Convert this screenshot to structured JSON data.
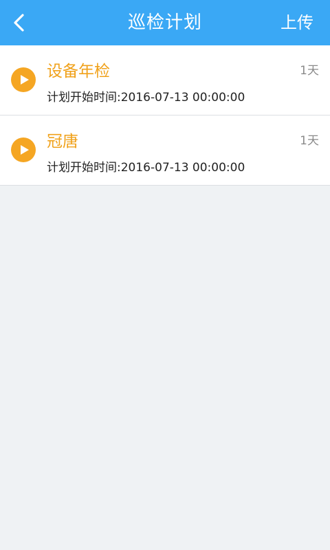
{
  "header": {
    "title": "巡检计划",
    "upload_label": "上传",
    "back_icon": "chevron-left-icon"
  },
  "colors": {
    "header_bg": "#3aa8f5",
    "accent_orange": "#f0a11a",
    "page_bg": "#eff2f4"
  },
  "plans": [
    {
      "title": "设备年检",
      "duration": "1天",
      "start_time": "计划开始时间:2016-07-13 00:00:00",
      "icon": "play-icon"
    },
    {
      "title": "冠唐",
      "duration": "1天",
      "start_time": "计划开始时间:2016-07-13 00:00:00",
      "icon": "play-icon"
    }
  ]
}
